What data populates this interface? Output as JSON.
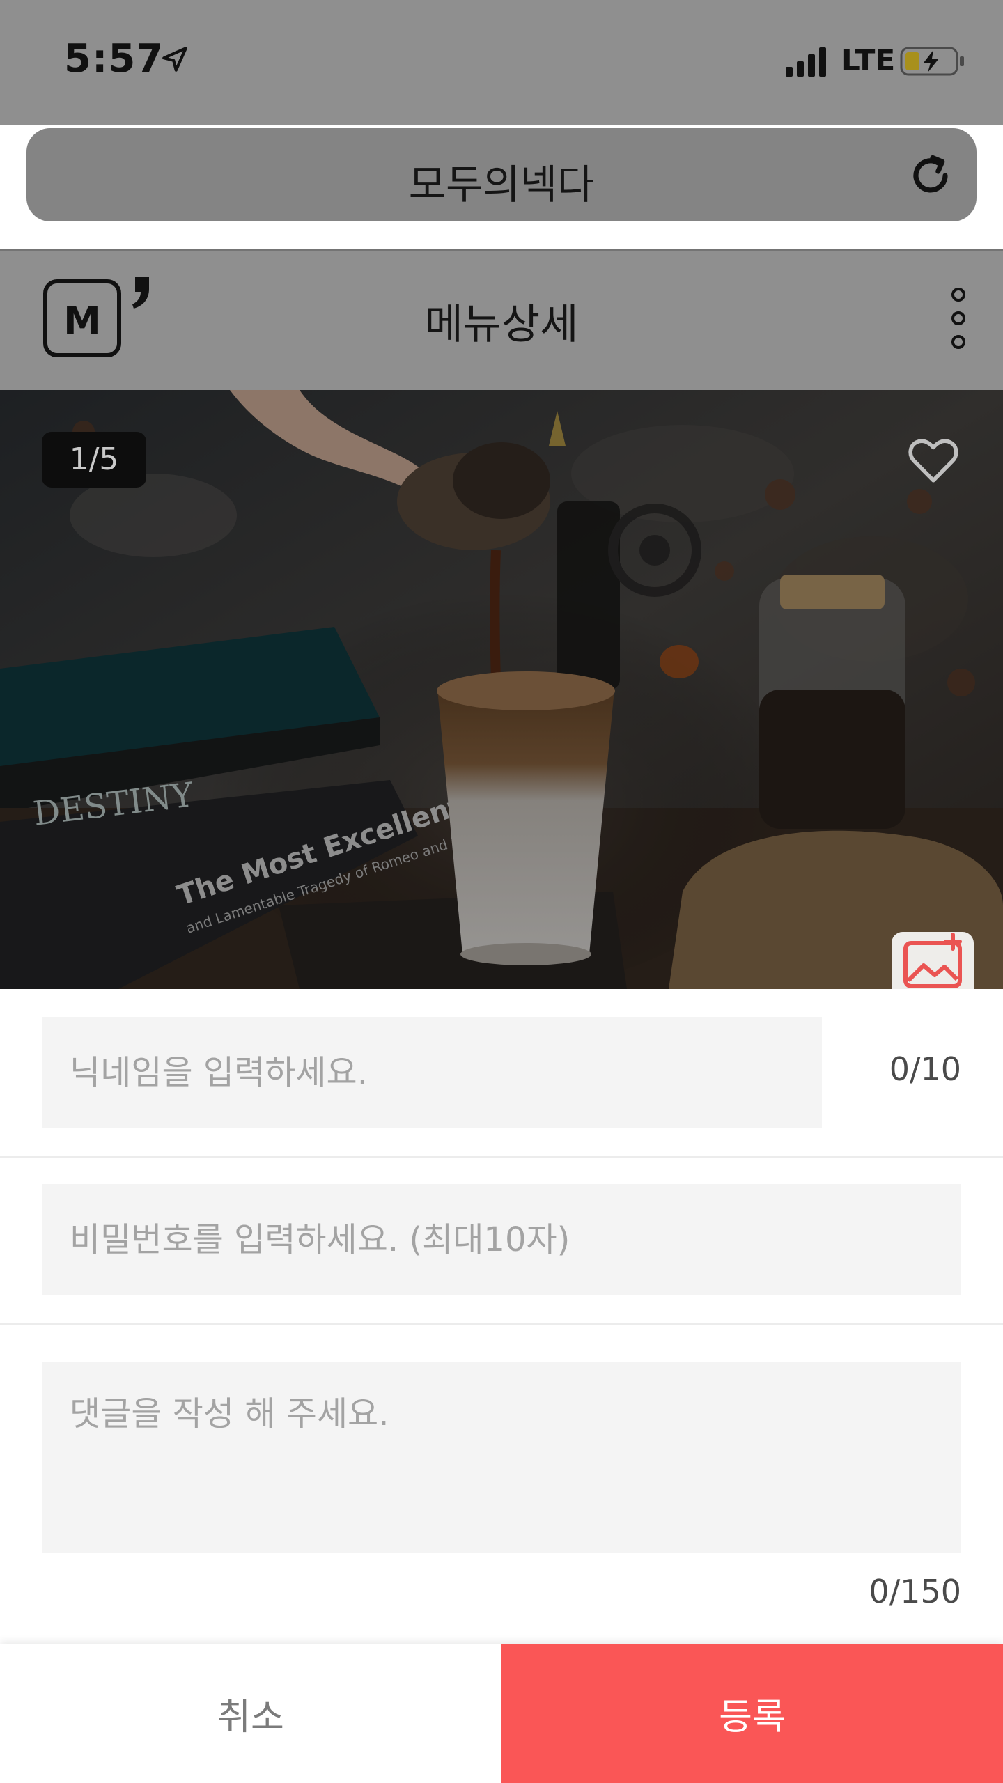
{
  "status_bar": {
    "time": "5:57",
    "network": "LTE",
    "icons": [
      "location-arrow-icon",
      "signal-icon",
      "battery-charging-icon"
    ]
  },
  "browser": {
    "url_title": "모두의넥다",
    "reload_icon": "reload-icon"
  },
  "header": {
    "logo_text": "M",
    "title": "메뉴상세",
    "menu_icon": "kebab-menu-icon"
  },
  "hero": {
    "counter": "1/5",
    "favorite_icon": "heart-icon",
    "add_photo_icon": "add-image-icon",
    "book_titles": [
      "DESTINY",
      "The Most Excellent",
      "and Lamentable Tragedy of Romeo and Juliet"
    ]
  },
  "form": {
    "nickname_placeholder": "닉네임을 입력하세요.",
    "nickname_count": "0/10",
    "password_placeholder": "비밀번호를 입력하세요. (최대10자)",
    "comment_placeholder": "댓글을 작성 해 주세요.",
    "comment_count": "0/150"
  },
  "buttons": {
    "cancel": "취소",
    "submit": "등록"
  },
  "colors": {
    "accent": "#fa5656",
    "overlay": "#8f8f8f",
    "field_bg": "#f4f4f4"
  }
}
